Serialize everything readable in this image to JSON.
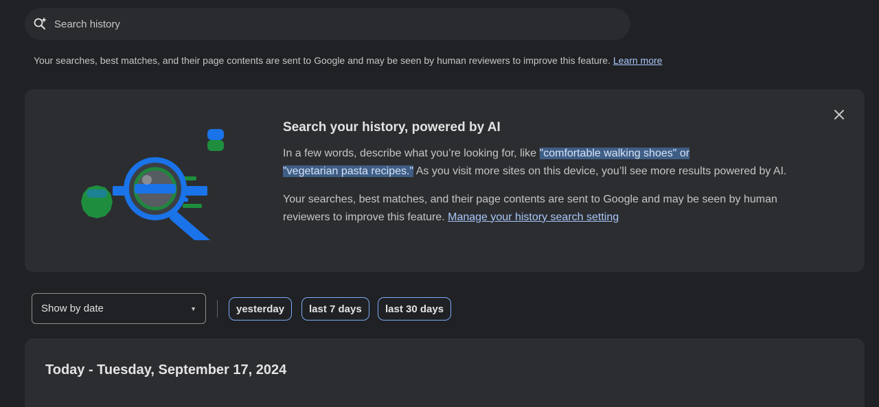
{
  "search": {
    "placeholder": "Search history",
    "icon": "search-sparkle-icon"
  },
  "disclaimer": {
    "text": "Your searches, best matches, and their page contents are sent to Google and may be seen by human reviewers to improve this feature.",
    "link": "Learn more"
  },
  "promo": {
    "title": "Search your history, powered by AI",
    "body1_pre": "In a few words, describe what you’re looking for, like",
    "body1_highlight1": "\"comfortable walking shoes\" or",
    "body1_highlight2": "\"vegetarian pasta recipes.\"",
    "body1_post": "As you visit more sites on this device, you’ll see more results powered by AI.",
    "body2_text": "Your searches, best matches, and their page contents are sent to Google and may be seen by human reviewers to improve this feature.",
    "body2_link": "Manage your history search setting",
    "close_icon": "close-icon",
    "illustration_icon": "magnifier-illustration"
  },
  "filters": {
    "show_by": "Show by date",
    "chips": [
      "yesterday",
      "last 7 days",
      "last 30 days"
    ]
  },
  "history": {
    "date_heading": "Today - Tuesday, September 17, 2024"
  },
  "colors": {
    "background": "#202124",
    "card": "#2c2d30",
    "link": "#a8c7fa",
    "highlight": "#3f5e86",
    "chip_border": "#7cacf8",
    "illustration_blue": "#1a73e8",
    "illustration_green": "#1e8e3e"
  }
}
